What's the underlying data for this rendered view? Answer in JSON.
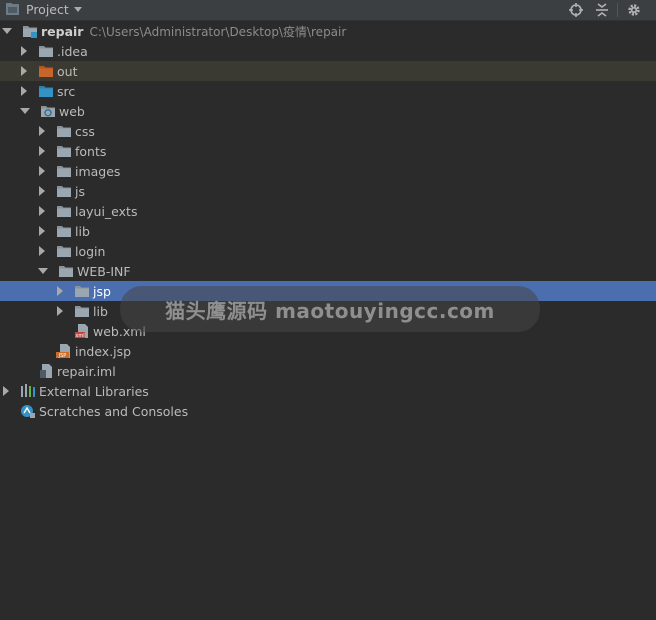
{
  "panel": {
    "title": "Project"
  },
  "colors": {
    "background": "#2b2b2b",
    "header": "#3c3f41",
    "selection": "#4b6eaf",
    "highlight": "#3b3a32",
    "folder": "#8a9199",
    "orange_folder": "#c7652a",
    "blue_folder": "#3592c4"
  },
  "icons": {
    "project": "project-icon",
    "locate": "crosshair-icon",
    "collapse": "collapse-all-icon",
    "settings": "gear-icon"
  },
  "tree": [
    {
      "label": "repair",
      "path": "C:\\Users\\Administrator\\Desktop\\疫情\\repair",
      "depth": 0,
      "arrow": "down",
      "icon": "module",
      "bold": true
    },
    {
      "label": ".idea",
      "depth": 1,
      "arrow": "right",
      "icon": "folder"
    },
    {
      "label": "out",
      "depth": 1,
      "arrow": "right",
      "icon": "folder-orange",
      "highlight": true
    },
    {
      "label": "src",
      "depth": 1,
      "arrow": "right",
      "icon": "folder-blue"
    },
    {
      "label": "web",
      "depth": 1,
      "arrow": "down",
      "icon": "folder-web"
    },
    {
      "label": "css",
      "depth": 2,
      "arrow": "right",
      "icon": "folder"
    },
    {
      "label": "fonts",
      "depth": 2,
      "arrow": "right",
      "icon": "folder"
    },
    {
      "label": "images",
      "depth": 2,
      "arrow": "right",
      "icon": "folder"
    },
    {
      "label": "js",
      "depth": 2,
      "arrow": "right",
      "icon": "folder"
    },
    {
      "label": "layui_exts",
      "depth": 2,
      "arrow": "right",
      "icon": "folder"
    },
    {
      "label": "lib",
      "depth": 2,
      "arrow": "right",
      "icon": "folder"
    },
    {
      "label": "login",
      "depth": 2,
      "arrow": "right",
      "icon": "folder"
    },
    {
      "label": "WEB-INF",
      "depth": 2,
      "arrow": "down",
      "icon": "folder"
    },
    {
      "label": "jsp",
      "depth": 3,
      "arrow": "right",
      "icon": "folder",
      "selected": true
    },
    {
      "label": "lib",
      "depth": 3,
      "arrow": "right",
      "icon": "folder"
    },
    {
      "label": "web.xml",
      "depth": 3,
      "arrow": "none",
      "icon": "xml-file"
    },
    {
      "label": "index.jsp",
      "depth": 2,
      "arrow": "none",
      "icon": "jsp-file"
    },
    {
      "label": "repair.iml",
      "depth": 1,
      "arrow": "none",
      "icon": "iml-file"
    },
    {
      "label": "External Libraries",
      "depth": 0,
      "arrow": "right",
      "icon": "libraries"
    },
    {
      "label": "Scratches and Consoles",
      "depth": 0,
      "arrow": "none",
      "icon": "scratches"
    }
  ],
  "watermark": {
    "text": "猫头鹰源码 maotouyingcc.com"
  }
}
